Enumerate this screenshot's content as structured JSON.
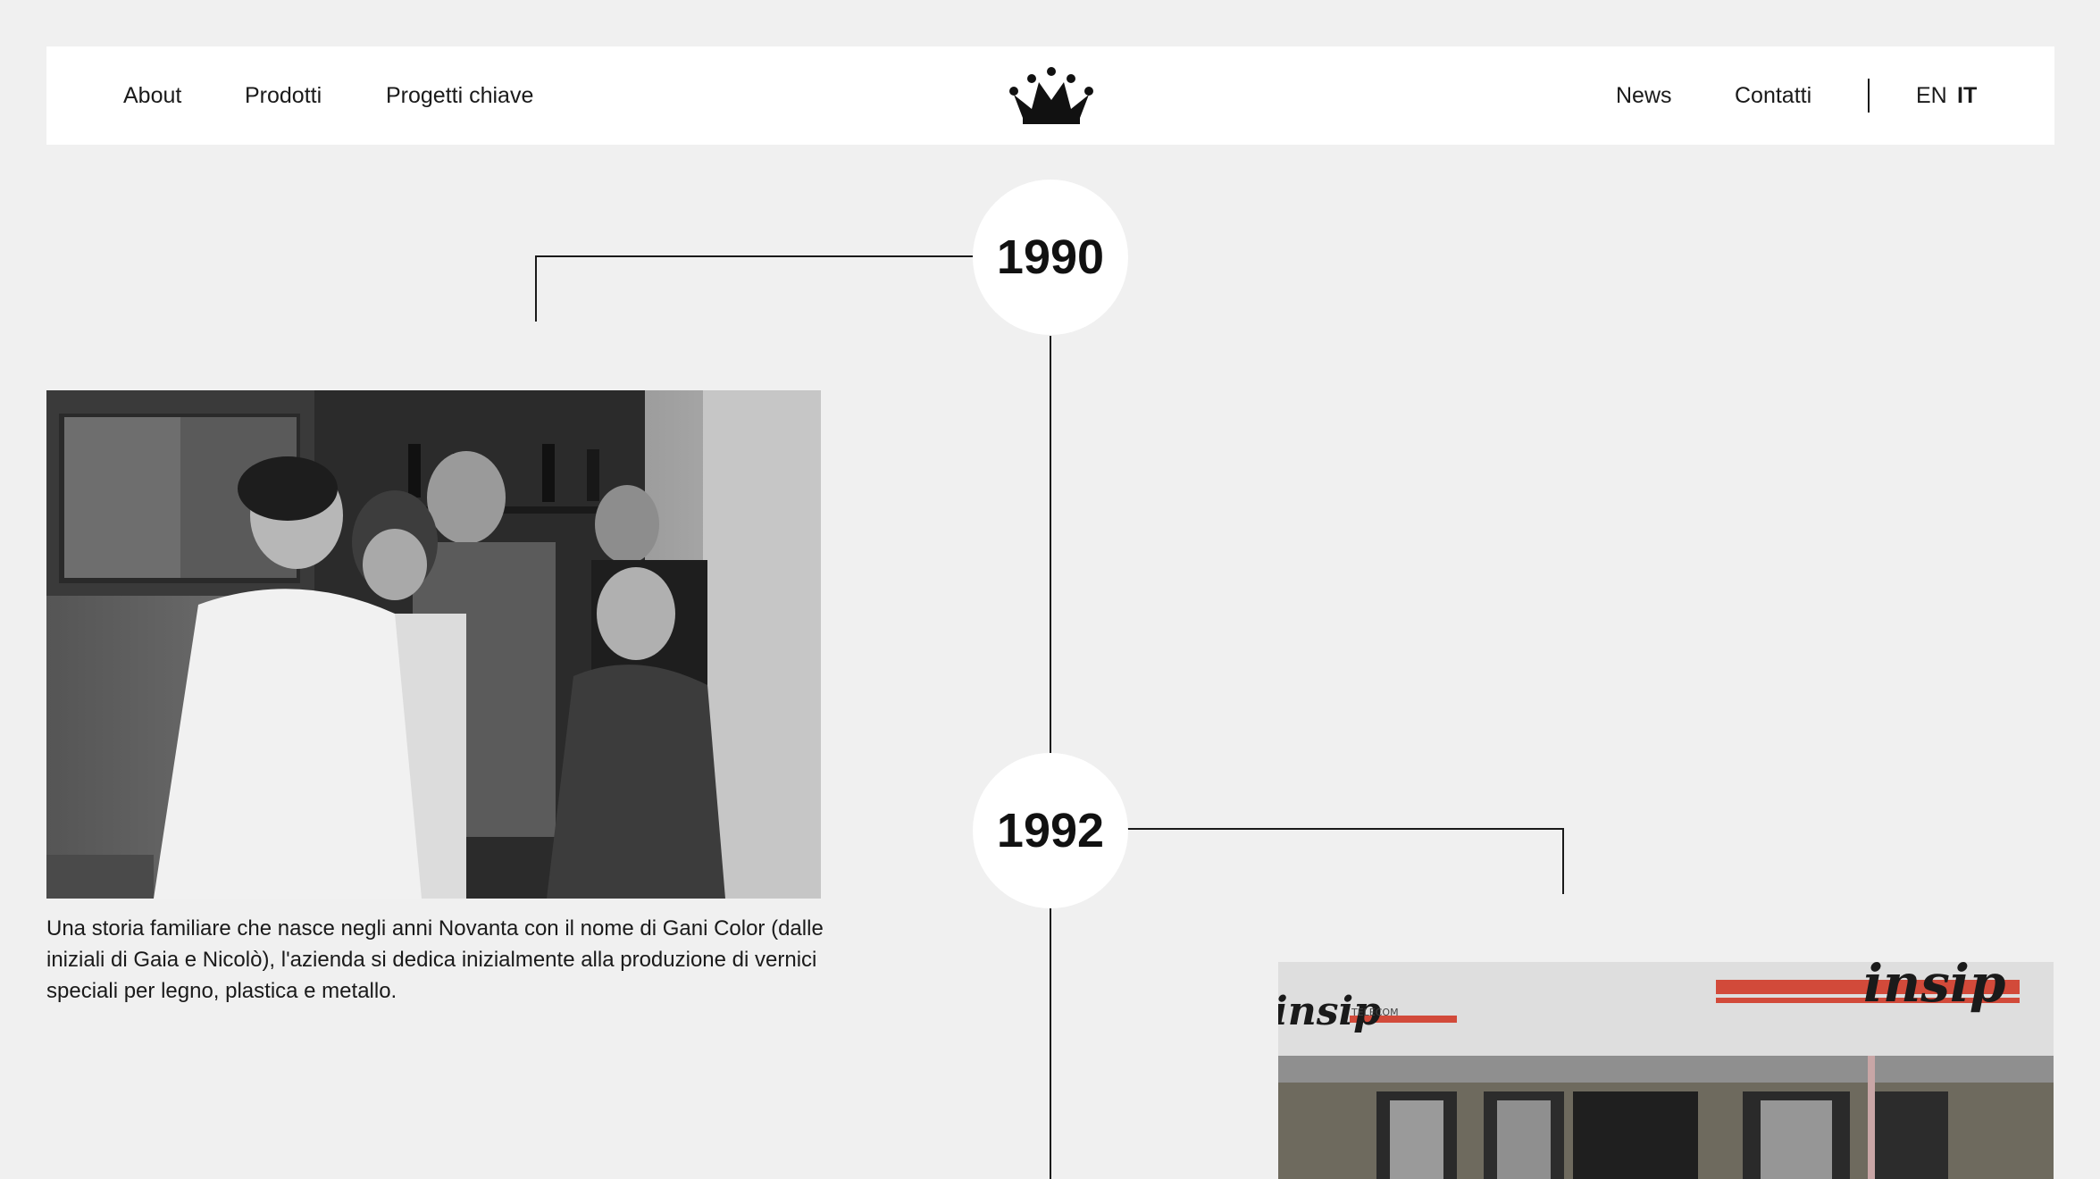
{
  "nav": {
    "about": "About",
    "prodotti": "Prodotti",
    "progetti": "Progetti chiave",
    "news": "News",
    "contatti": "Contatti",
    "lang_en": "EN",
    "lang_it": "IT"
  },
  "logo": {
    "icon": "crown-icon"
  },
  "timeline": [
    {
      "year": "1990",
      "caption": "Una storia familiare che nasce negli anni Novanta con il nome di Gani Color (dalle iniziali di Gaia e Nicolò), l'azienda si dedica inizialmente alla produzione di vernici speciali per legno, plastica e metallo."
    },
    {
      "year": "1992",
      "sign_text": "insip",
      "sign_small": "TELECOM"
    }
  ],
  "colors": {
    "background": "#f0f0f0",
    "header": "#ffffff",
    "text": "#1a1a1a",
    "sign_red": "#d24a3a"
  }
}
